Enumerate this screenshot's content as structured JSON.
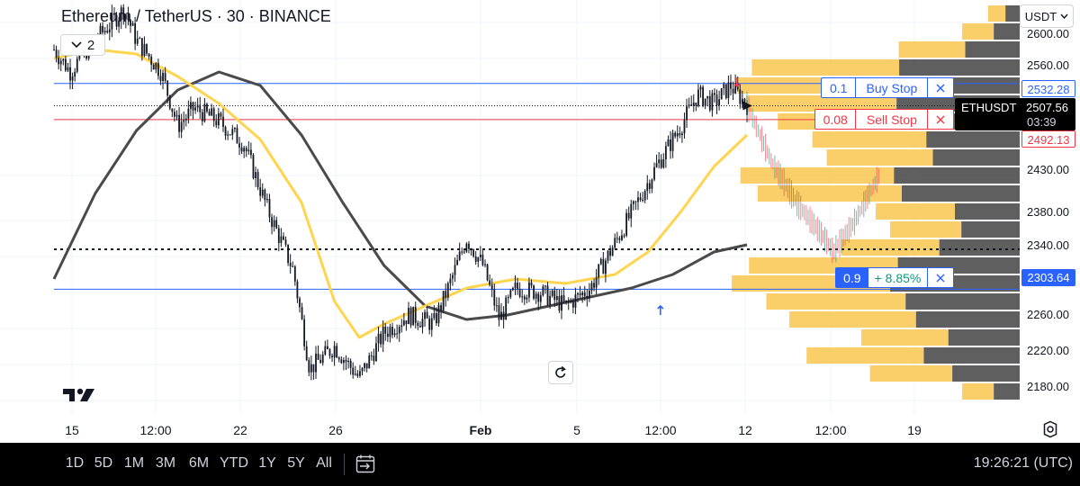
{
  "header": {
    "title": "Ethereum / TetherUS · 30 · BINANCE",
    "indicator_count": "2",
    "currency": "USDT"
  },
  "price_axis": {
    "ticks": [
      "2600.00",
      "2560.00",
      "2430.00",
      "2380.00",
      "2340.00",
      "2260.00",
      "2220.00",
      "2180.00"
    ]
  },
  "badges": {
    "buy_stop_price": "2532.28",
    "sell_stop_price": "2492.13",
    "position_price": "2303.64",
    "last_symbol": "ETHUSDT",
    "last_price": "2507.56",
    "countdown": "03:39"
  },
  "orders": {
    "buy_stop": {
      "qty": "0.1",
      "label": "Buy Stop"
    },
    "sell_stop": {
      "qty": "0.08",
      "label": "Sell Stop"
    },
    "position": {
      "qty": "0.9",
      "label": "+ 8.85%"
    }
  },
  "time_axis": [
    {
      "label": "15",
      "bold": false
    },
    {
      "label": "12:00",
      "bold": false
    },
    {
      "label": "22",
      "bold": false
    },
    {
      "label": "26",
      "bold": false
    },
    {
      "label": "Feb",
      "bold": true
    },
    {
      "label": "5",
      "bold": false
    },
    {
      "label": "12:00",
      "bold": false
    },
    {
      "label": "12",
      "bold": false
    },
    {
      "label": "12:00",
      "bold": false
    },
    {
      "label": "19",
      "bold": false
    }
  ],
  "ranges": [
    "1D",
    "5D",
    "1M",
    "3M",
    "6M",
    "YTD",
    "1Y",
    "5Y",
    "All"
  ],
  "clock": "19:26:21 (UTC)",
  "colors": {
    "up": "#089981",
    "down": "#f23645",
    "accent": "#2962ff",
    "ma_yellow": "#ffd54f",
    "cycle_line": "#4a4a4a",
    "volume_profile": "#f9c74f"
  },
  "chart_data": {
    "type": "candlestick",
    "symbol": "ETHUSDT",
    "interval": "30",
    "exchange": "BINANCE",
    "ylim": [
      2165,
      2625
    ],
    "grid": true,
    "horizontal_levels": [
      {
        "price": 2532.28,
        "kind": "buy_stop"
      },
      {
        "price": 2492.13,
        "kind": "sell_stop"
      },
      {
        "price": 2303.64,
        "kind": "position"
      },
      {
        "price": 2348,
        "kind": "dotted"
      }
    ],
    "price_path": [
      {
        "t": 0.0,
        "p": 2570
      },
      {
        "t": 0.02,
        "p": 2545
      },
      {
        "t": 0.035,
        "p": 2565
      },
      {
        "t": 0.06,
        "p": 2590
      },
      {
        "t": 0.085,
        "p": 2615
      },
      {
        "t": 0.1,
        "p": 2580
      },
      {
        "t": 0.13,
        "p": 2545
      },
      {
        "t": 0.15,
        "p": 2485
      },
      {
        "t": 0.17,
        "p": 2505
      },
      {
        "t": 0.2,
        "p": 2490
      },
      {
        "t": 0.23,
        "p": 2465
      },
      {
        "t": 0.26,
        "p": 2390
      },
      {
        "t": 0.29,
        "p": 2325
      },
      {
        "t": 0.31,
        "p": 2215
      },
      {
        "t": 0.34,
        "p": 2240
      },
      {
        "t": 0.37,
        "p": 2205
      },
      {
        "t": 0.4,
        "p": 2255
      },
      {
        "t": 0.43,
        "p": 2275
      },
      {
        "t": 0.46,
        "p": 2265
      },
      {
        "t": 0.48,
        "p": 2310
      },
      {
        "t": 0.5,
        "p": 2360
      },
      {
        "t": 0.52,
        "p": 2330
      },
      {
        "t": 0.54,
        "p": 2270
      },
      {
        "t": 0.56,
        "p": 2305
      },
      {
        "t": 0.59,
        "p": 2300
      },
      {
        "t": 0.62,
        "p": 2285
      },
      {
        "t": 0.65,
        "p": 2305
      },
      {
        "t": 0.68,
        "p": 2355
      },
      {
        "t": 0.71,
        "p": 2405
      },
      {
        "t": 0.73,
        "p": 2440
      },
      {
        "t": 0.76,
        "p": 2485
      },
      {
        "t": 0.78,
        "p": 2520
      },
      {
        "t": 0.8,
        "p": 2510
      },
      {
        "t": 0.82,
        "p": 2530
      },
      {
        "t": 0.84,
        "p": 2508
      }
    ],
    "projection_path": [
      {
        "t": 0.84,
        "p": 2508
      },
      {
        "t": 0.87,
        "p": 2445
      },
      {
        "t": 0.9,
        "p": 2400
      },
      {
        "t": 0.93,
        "p": 2365
      },
      {
        "t": 0.945,
        "p": 2345
      },
      {
        "t": 0.97,
        "p": 2378
      },
      {
        "t": 1.0,
        "p": 2430
      }
    ],
    "moving_average": [
      {
        "t": 0.0,
        "p": 2560
      },
      {
        "t": 0.05,
        "p": 2570
      },
      {
        "t": 0.1,
        "p": 2565
      },
      {
        "t": 0.15,
        "p": 2540
      },
      {
        "t": 0.2,
        "p": 2510
      },
      {
        "t": 0.25,
        "p": 2470
      },
      {
        "t": 0.3,
        "p": 2400
      },
      {
        "t": 0.34,
        "p": 2290
      },
      {
        "t": 0.37,
        "p": 2250
      },
      {
        "t": 0.4,
        "p": 2265
      },
      {
        "t": 0.45,
        "p": 2285
      },
      {
        "t": 0.5,
        "p": 2305
      },
      {
        "t": 0.56,
        "p": 2315
      },
      {
        "t": 0.62,
        "p": 2310
      },
      {
        "t": 0.68,
        "p": 2320
      },
      {
        "t": 0.72,
        "p": 2345
      },
      {
        "t": 0.76,
        "p": 2390
      },
      {
        "t": 0.8,
        "p": 2440
      },
      {
        "t": 0.84,
        "p": 2475
      }
    ],
    "cycle_curve": [
      {
        "t": 0.0,
        "p": 2315
      },
      {
        "t": 0.05,
        "p": 2410
      },
      {
        "t": 0.1,
        "p": 2480
      },
      {
        "t": 0.15,
        "p": 2525
      },
      {
        "t": 0.2,
        "p": 2545
      },
      {
        "t": 0.25,
        "p": 2530
      },
      {
        "t": 0.3,
        "p": 2475
      },
      {
        "t": 0.35,
        "p": 2400
      },
      {
        "t": 0.4,
        "p": 2330
      },
      {
        "t": 0.45,
        "p": 2285
      },
      {
        "t": 0.5,
        "p": 2270
      },
      {
        "t": 0.55,
        "p": 2275
      },
      {
        "t": 0.6,
        "p": 2285
      },
      {
        "t": 0.65,
        "p": 2295
      },
      {
        "t": 0.7,
        "p": 2305
      },
      {
        "t": 0.75,
        "p": 2320
      },
      {
        "t": 0.8,
        "p": 2345
      },
      {
        "t": 0.84,
        "p": 2353
      }
    ],
    "volume_profile": [
      {
        "price": 2610,
        "value": 0.11
      },
      {
        "price": 2590,
        "value": 0.2
      },
      {
        "price": 2570,
        "value": 0.42
      },
      {
        "price": 2550,
        "value": 0.93
      },
      {
        "price": 2530,
        "value": 0.98
      },
      {
        "price": 2510,
        "value": 0.95
      },
      {
        "price": 2490,
        "value": 0.84
      },
      {
        "price": 2470,
        "value": 0.72
      },
      {
        "price": 2450,
        "value": 0.67
      },
      {
        "price": 2430,
        "value": 0.97
      },
      {
        "price": 2410,
        "value": 0.91
      },
      {
        "price": 2390,
        "value": 0.5
      },
      {
        "price": 2370,
        "value": 0.45
      },
      {
        "price": 2350,
        "value": 0.62
      },
      {
        "price": 2330,
        "value": 0.94
      },
      {
        "price": 2310,
        "value": 1.0
      },
      {
        "price": 2290,
        "value": 0.88
      },
      {
        "price": 2270,
        "value": 0.8
      },
      {
        "price": 2250,
        "value": 0.55
      },
      {
        "price": 2230,
        "value": 0.74
      },
      {
        "price": 2210,
        "value": 0.52
      },
      {
        "price": 2190,
        "value": 0.2
      }
    ]
  }
}
